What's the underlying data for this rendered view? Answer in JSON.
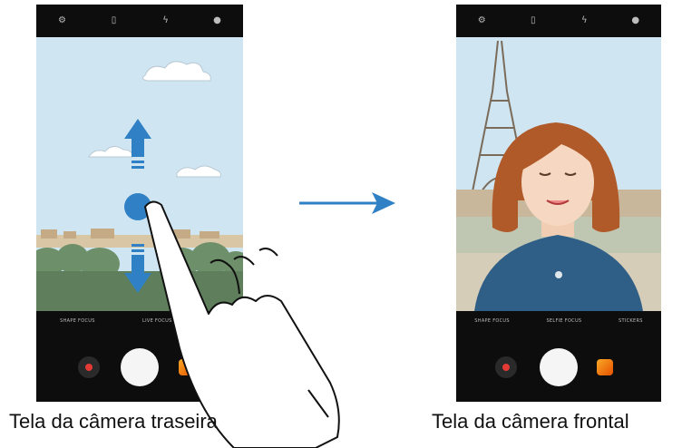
{
  "rear": {
    "top_icons": [
      "settings-icon",
      "hdr-icon",
      "flash-icon",
      "filter-icon"
    ],
    "modes": [
      "SHAPE FOCUS",
      "LIVE FOCUS"
    ],
    "caption": "Tela da câmera traseira",
    "swipe_direction": "vertical"
  },
  "front": {
    "top_icons": [
      "settings-icon",
      "hdr-icon",
      "flash-icon",
      "filter-icon"
    ],
    "modes": [
      "SHAPE FOCUS",
      "SELFIE FOCUS",
      "STICKERS"
    ],
    "caption": "Tela da câmera frontal"
  },
  "colors": {
    "sky_rear": "#cfe6f2",
    "sky_front": "#cfe6f2",
    "accent_blue": "#3a7fb5",
    "arrow_blue": "#2f80c4",
    "hair": "#b05a2a",
    "shirt": "#2f5f86"
  }
}
